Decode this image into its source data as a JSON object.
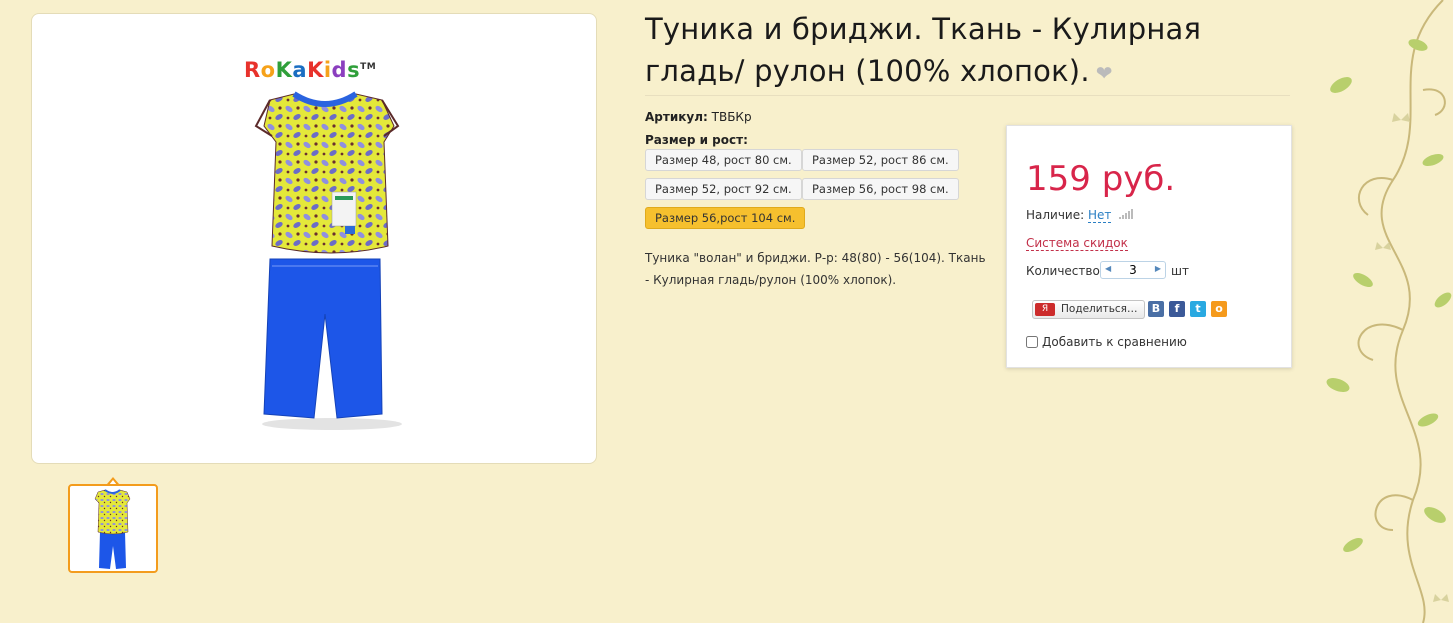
{
  "product": {
    "title": "Туника и бриджи. Ткань - Кулирная гладь/ рулон (100% хлопок).",
    "favorite_icon": "heart-icon",
    "brand_logo": {
      "letters": [
        "R",
        "o",
        "K",
        "a",
        "K",
        "i",
        "d",
        "s"
      ],
      "letter_colors": [
        "#e8322c",
        "#f6a21a",
        "#2f9f3a",
        "#1b6ec2",
        "#e8322c",
        "#f6a21a",
        "#8b3fbf",
        "#2f9f3a"
      ],
      "tm": "TM"
    },
    "sku_label": "Артикул:",
    "sku_value": "ТВБКр",
    "size_label": "Размер и рост:",
    "sizes": [
      {
        "label": "Размер 48, рост 80 см.",
        "active": false
      },
      {
        "label": "Размер 52, рост 86 см.",
        "active": false
      },
      {
        "label": "Размер 52, рост 92 см.",
        "active": false
      },
      {
        "label": "Размер 56, рост 98 см.",
        "active": false
      },
      {
        "label": "Размер 56,рост 104 см.",
        "active": true
      }
    ],
    "description": "Туника \"волан\" и бриджи. Р-р: 48(80) - 56(104). Ткань - Кулирная гладь/рулон (100% хлопок)."
  },
  "buy": {
    "price": "159 руб.",
    "availability_label": "Наличие:",
    "availability_value": "Нет",
    "discount_link": "Система скидок",
    "qty_label": "Количество:",
    "qty_value": "3",
    "qty_unit": "шт",
    "share_label": "Поделиться…",
    "share_logo": "Я",
    "social": [
      {
        "name": "vk",
        "glyph": "B",
        "color": "#4a6fa5"
      },
      {
        "name": "facebook",
        "glyph": "f",
        "color": "#3b5998"
      },
      {
        "name": "twitter",
        "glyph": "t",
        "color": "#29a9e1"
      },
      {
        "name": "odnoklassniki",
        "glyph": "о",
        "color": "#f59a1c"
      }
    ],
    "compare_label": "Добавить к сравнению"
  },
  "colors": {
    "background": "#f8f0cc",
    "price": "#d8254a",
    "active_size": "#f6c02e",
    "thumb_border": "#f39c1d"
  }
}
